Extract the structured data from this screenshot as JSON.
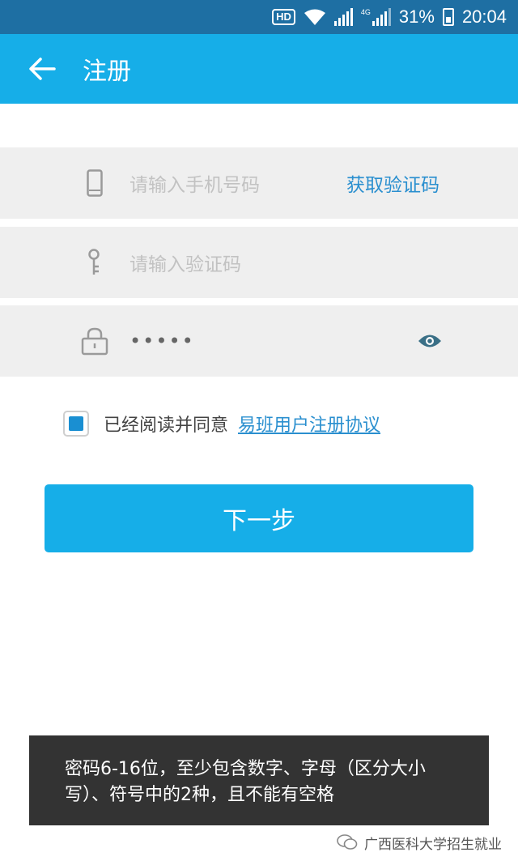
{
  "status_bar": {
    "hd_badge": "HD",
    "network_label": "4G",
    "battery_percent": "31%",
    "time": "20:04",
    "icons": [
      "wifi-icon",
      "signal-icon",
      "signal-4g-icon",
      "battery-icon"
    ]
  },
  "app_bar": {
    "title": "注册",
    "back_icon": "arrow-left-icon"
  },
  "form": {
    "phone": {
      "placeholder": "请输入手机号码",
      "icon": "phone-icon",
      "get_code_label": "获取验证码"
    },
    "code": {
      "placeholder": "请输入验证码",
      "icon": "key-icon"
    },
    "password": {
      "value": "•••••",
      "icon": "lock-icon",
      "toggle_icon": "eye-icon"
    }
  },
  "agreement": {
    "checked": true,
    "text": "已经阅读并同意",
    "link_text": "易班用户注册协议"
  },
  "next_button": {
    "label": "下一步"
  },
  "toast": {
    "message": "密码6-16位，至少包含数字、字母（区分大小写）、符号中的2种，且不能有空格"
  },
  "watermark": {
    "text": "广西医科大学招生就业"
  },
  "colors": {
    "status_bar": "#1e6fa3",
    "primary": "#16aee8",
    "link": "#2a8fcf",
    "field_bg": "#efefef",
    "toast_bg": "#333333"
  }
}
